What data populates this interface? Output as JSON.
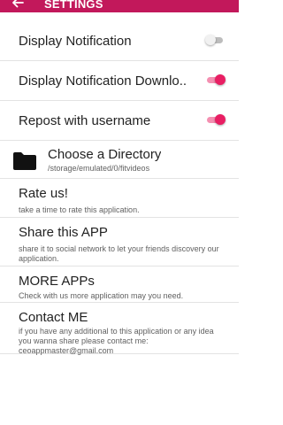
{
  "appbar": {
    "title": "SETTINGS",
    "back_icon": "arrow-left-icon",
    "color": "#c2185b"
  },
  "settings": {
    "display_notification": {
      "label": "Display Notification",
      "enabled": false
    },
    "display_notification_download": {
      "label": "Display Notification Downlo..",
      "enabled": true
    },
    "repost_username": {
      "label": "Repost with username",
      "enabled": true
    },
    "directory": {
      "label": "Choose a Directory",
      "path": "/storage/emulated/0/fitvideos",
      "icon": "folder-icon"
    },
    "rate": {
      "label": "Rate us!",
      "description": "take a time to rate this application."
    },
    "share": {
      "label": "Share this APP",
      "description": "share it to social network to let your friends discovery our application."
    },
    "more": {
      "label": "MORE APPs",
      "description": "Check with us more application may you need."
    },
    "contact": {
      "label": "Contact ME",
      "description": "if you have any additional to this application or any idea you wanna share please contact me:",
      "email": "ceoappmaster@gmail.com"
    }
  },
  "colors": {
    "accent": "#e91e63",
    "accent_track": "#f48fb1",
    "switch_off_track": "#bdbdbd"
  }
}
